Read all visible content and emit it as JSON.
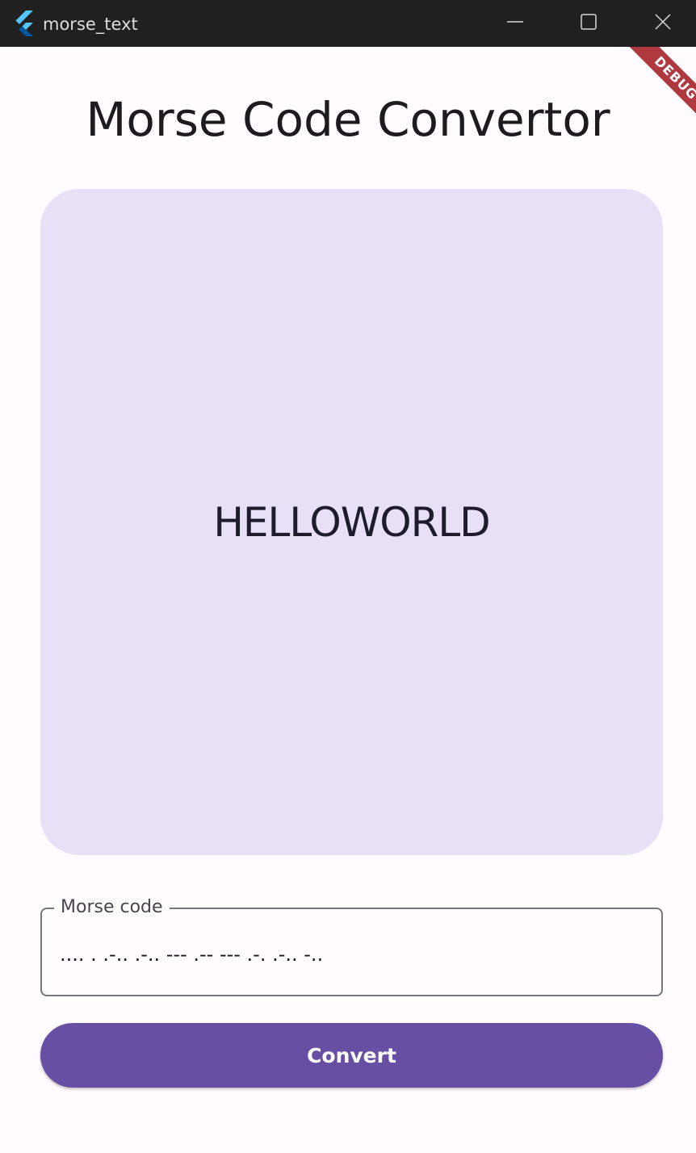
{
  "window": {
    "title": "morse_text",
    "banner": "DEBUG"
  },
  "page": {
    "title": "Morse Code Convertor"
  },
  "output": {
    "text": "HELLOWORLD"
  },
  "morse_field": {
    "label": "Morse code",
    "value": ".... . .-.. .-.. --- .-- --- .-. .-.. -.."
  },
  "convert_button": {
    "label": "Convert"
  },
  "colors": {
    "titlebar": "#202020",
    "background": "#fffbff",
    "card": "#e7e0f6",
    "primary": "#6750a4",
    "debug_banner": "#b0383f"
  },
  "icons": {
    "app": "flutter-logo-icon",
    "minimize": "minimize-icon",
    "maximize": "maximize-icon",
    "close": "close-icon"
  }
}
